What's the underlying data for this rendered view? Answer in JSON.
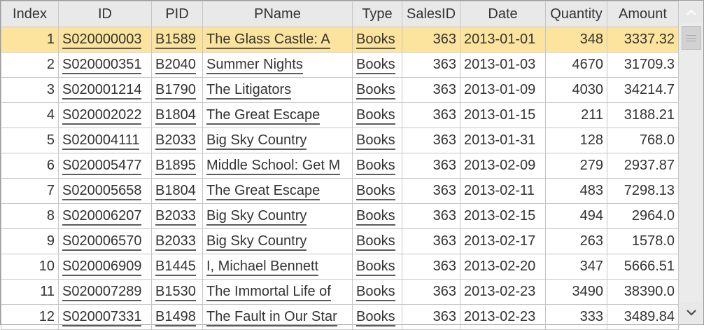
{
  "table": {
    "columns": [
      "Index",
      "ID",
      "PID",
      "PName",
      "Type",
      "SalesID",
      "Date",
      "Quantity",
      "Amount"
    ],
    "selected_row": 0,
    "rows": [
      {
        "index": "1",
        "id": "S020000003",
        "pid": "B1589",
        "pname": "The Glass Castle: A",
        "type": "Books",
        "salesid": "363",
        "date": "2013-01-01",
        "quantity": "348",
        "amount": "3337.32"
      },
      {
        "index": "2",
        "id": "S020000351",
        "pid": "B2040",
        "pname": "Summer Nights",
        "type": "Books",
        "salesid": "363",
        "date": "2013-01-03",
        "quantity": "4670",
        "amount": "31709.3"
      },
      {
        "index": "3",
        "id": "S020001214",
        "pid": "B1790",
        "pname": "The Litigators",
        "type": "Books",
        "salesid": "363",
        "date": "2013-01-09",
        "quantity": "4030",
        "amount": "34214.7"
      },
      {
        "index": "4",
        "id": "S020002022",
        "pid": "B1804",
        "pname": "The Great Escape",
        "type": "Books",
        "salesid": "363",
        "date": "2013-01-15",
        "quantity": "211",
        "amount": "3188.21"
      },
      {
        "index": "5",
        "id": "S020004111",
        "pid": "B2033",
        "pname": "Big Sky Country",
        "type": "Books",
        "salesid": "363",
        "date": "2013-01-31",
        "quantity": "128",
        "amount": "768.0"
      },
      {
        "index": "6",
        "id": "S020005477",
        "pid": "B1895",
        "pname": "Middle School: Get M",
        "type": "Books",
        "salesid": "363",
        "date": "2013-02-09",
        "quantity": "279",
        "amount": "2937.87"
      },
      {
        "index": "7",
        "id": "S020005658",
        "pid": "B1804",
        "pname": "The Great Escape",
        "type": "Books",
        "salesid": "363",
        "date": "2013-02-11",
        "quantity": "483",
        "amount": "7298.13"
      },
      {
        "index": "8",
        "id": "S020006207",
        "pid": "B2033",
        "pname": "Big Sky Country",
        "type": "Books",
        "salesid": "363",
        "date": "2013-02-15",
        "quantity": "494",
        "amount": "2964.0"
      },
      {
        "index": "9",
        "id": "S020006570",
        "pid": "B2033",
        "pname": "Big Sky Country",
        "type": "Books",
        "salesid": "363",
        "date": "2013-02-17",
        "quantity": "263",
        "amount": "1578.0"
      },
      {
        "index": "10",
        "id": "S020006909",
        "pid": "B1445",
        "pname": "I, Michael Bennett",
        "type": "Books",
        "salesid": "363",
        "date": "2013-02-20",
        "quantity": "347",
        "amount": "5666.51"
      },
      {
        "index": "11",
        "id": "S020007289",
        "pid": "B1530",
        "pname": "The Immortal Life of",
        "type": "Books",
        "salesid": "363",
        "date": "2013-02-23",
        "quantity": "3490",
        "amount": "38390.0"
      },
      {
        "index": "12",
        "id": "S020007331",
        "pid": "B1498",
        "pname": "The Fault in Our Star",
        "type": "Books",
        "salesid": "363",
        "date": "2013-02-23",
        "quantity": "333",
        "amount": "3489.84"
      }
    ]
  },
  "colors": {
    "selected_row_bg": "#fde49e",
    "header_bg": "#e9e9e9",
    "number_blue": "#1a1adf",
    "amount_brown": "#a0615f"
  },
  "scrollbar": {
    "up_icon": "chevron-up-icon",
    "down_icon": "chevron-down-icon"
  }
}
